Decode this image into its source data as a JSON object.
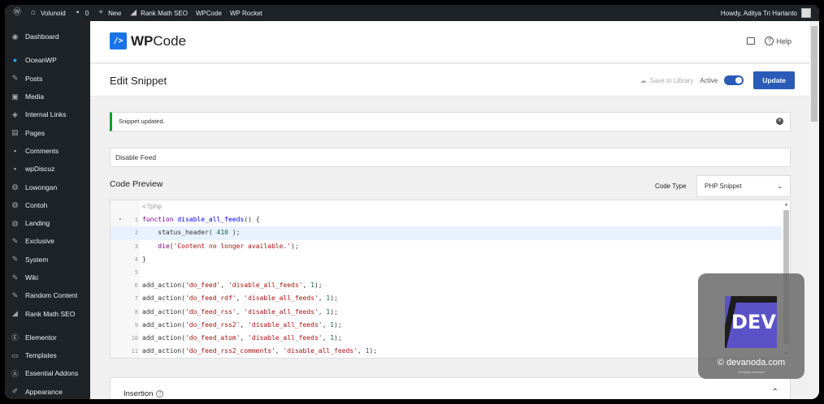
{
  "adminbar": {
    "site": "Volunoid",
    "comments_count": "0",
    "new_label": "New",
    "rankmath": "Rank Math SEO",
    "wpcode": "WPCode",
    "wprocket": "WP Rocket",
    "howdy": "Howdy, Aditya Tri Hartanto"
  },
  "sidebar": {
    "items": [
      {
        "label": "Dashboard",
        "icon": "dashboard-icon"
      },
      {
        "label": "OceanWP",
        "icon": "oceanwp-icon"
      },
      {
        "label": "Posts",
        "icon": "pin-icon"
      },
      {
        "label": "Media",
        "icon": "media-icon"
      },
      {
        "label": "Internal Links",
        "icon": "link-icon"
      },
      {
        "label": "Pages",
        "icon": "pages-icon"
      },
      {
        "label": "Comments",
        "icon": "comment-icon"
      },
      {
        "label": "wpDiscuz",
        "icon": "comment-icon"
      },
      {
        "label": "Lowongan",
        "icon": "globe-icon"
      },
      {
        "label": "Contoh",
        "icon": "globe-icon"
      },
      {
        "label": "Landing",
        "icon": "globe-icon"
      },
      {
        "label": "Exclusive",
        "icon": "pin-icon"
      },
      {
        "label": "System",
        "icon": "pin-icon"
      },
      {
        "label": "Wiki",
        "icon": "pin-icon"
      },
      {
        "label": "Random Content",
        "icon": "pin-icon"
      },
      {
        "label": "Rank Math SEO",
        "icon": "chart-icon"
      },
      {
        "label": "Elementor",
        "icon": "elementor-icon"
      },
      {
        "label": "Templates",
        "icon": "folder-icon"
      },
      {
        "label": "Essential Addons",
        "icon": "ea-icon"
      },
      {
        "label": "Appearance",
        "icon": "brush-icon"
      }
    ]
  },
  "header": {
    "logo_wp": "WP",
    "logo_code": "Code",
    "help": "Help"
  },
  "titlebar": {
    "title": "Edit Snippet",
    "save_to_library": "Save to Library",
    "active": "Active",
    "update": "Update"
  },
  "notice": {
    "text": "Snippet updated."
  },
  "snippet": {
    "name": "Disable Feed",
    "code_preview_label": "Code Preview",
    "code_type_label": "Code Type",
    "code_type_value": "PHP Snippet"
  },
  "code": {
    "header": "<?php",
    "lines": [
      {
        "n": "1",
        "text": "function disable_all_feeds() {"
      },
      {
        "n": "2",
        "text": "    status_header( 410 );"
      },
      {
        "n": "3",
        "text": "    die('Content no longer available.');"
      },
      {
        "n": "4",
        "text": "}"
      },
      {
        "n": "5",
        "text": ""
      },
      {
        "n": "6",
        "text": "add_action('do_feed', 'disable_all_feeds', 1);"
      },
      {
        "n": "7",
        "text": "add_action('do_feed_rdf', 'disable_all_feeds', 1);"
      },
      {
        "n": "8",
        "text": "add_action('do_feed_rss', 'disable_all_feeds', 1);"
      },
      {
        "n": "9",
        "text": "add_action('do_feed_rss2', 'disable_all_feeds', 1);"
      },
      {
        "n": "10",
        "text": "add_action('do_feed_atom', 'disable_all_feeds', 1);"
      },
      {
        "n": "11",
        "text": "add_action('do_feed_rss2_comments', 'disable_all_feeds', 1);"
      }
    ]
  },
  "insertion": {
    "title": "Insertion"
  },
  "watermark": {
    "logo": "DEV",
    "url": "© devanoda.com",
    "small": "All rights reserved"
  }
}
